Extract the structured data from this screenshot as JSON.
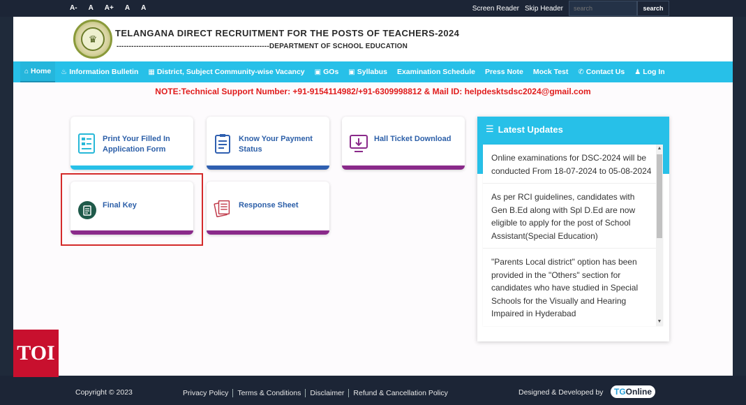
{
  "topbar": {
    "font_controls": [
      "A-",
      "A",
      "A+",
      "A",
      "A"
    ],
    "screen_reader": "Screen Reader",
    "skip_header": "Skip Header",
    "search_placeholder": "search",
    "search_button": "search"
  },
  "header": {
    "title": "TELANGANA DIRECT RECRUITMENT FOR THE POSTS OF TEACHERS-2024",
    "subtitle": "--------------------------------------------------------------DEPARTMENT OF SCHOOL EDUCATION"
  },
  "nav": {
    "items": [
      {
        "label": "Home",
        "icon": "home-icon"
      },
      {
        "label": "Information Bulletin",
        "icon": "bell-icon"
      },
      {
        "label": "District, Subject Community-wise Vacancy",
        "icon": "calendar-icon"
      },
      {
        "label": "GOs",
        "icon": "image-icon"
      },
      {
        "label": "Syllabus",
        "icon": "book-icon"
      },
      {
        "label": "Examination Schedule",
        "icon": ""
      },
      {
        "label": "Press Note",
        "icon": ""
      },
      {
        "label": "Mock Test",
        "icon": ""
      },
      {
        "label": "Contact Us",
        "icon": "phone-icon"
      },
      {
        "label": "Log In",
        "icon": "user-icon"
      }
    ]
  },
  "note": "NOTE:Technical Support Number: +91-9154114982/+91-6309998812 & Mail ID: helpdesktsdsc2024@gmail.com",
  "tiles": [
    {
      "label": "Print Your Filled In Application Form",
      "icon": "form-icon",
      "bar_color": "#27c0e8"
    },
    {
      "label": "Know Your Payment Status",
      "icon": "payment-icon",
      "bar_color": "#2f5fb0"
    },
    {
      "label": "Hall Ticket Download",
      "icon": "download-icon",
      "bar_color": "#8a2a8a"
    },
    {
      "label": "Final Key",
      "icon": "clipboard-icon",
      "bar_color": "#8a2a8a"
    },
    {
      "label": "Response Sheet",
      "icon": "sheets-icon",
      "bar_color": "#8a2a8a"
    }
  ],
  "updates": {
    "title": "Latest Updates",
    "items": [
      "Online examinations for DSC-2024 will be conducted From 18-07-2024 to 05-08-2024",
      "As per RCI guidelines, candidates with Gen B.Ed along with Spl D.Ed are now eligible to apply for the post of School Assistant(Special Education)",
      "\"Parents Local district\" option has been provided in the \"Others\" section for candidates who have studied in Special Schools for the Visually and Hearing Impaired in Hyderabad"
    ]
  },
  "footer": {
    "copyright": "Copyright © 2023",
    "links": [
      "Privacy Policy",
      "Terms & Conditions",
      "Disclaimer",
      "Refund & Cancellation Policy"
    ],
    "designed_by": "Designed & Developed by",
    "brand_prefix": "TG",
    "brand_suffix": "Online"
  },
  "watermark": "TOI"
}
